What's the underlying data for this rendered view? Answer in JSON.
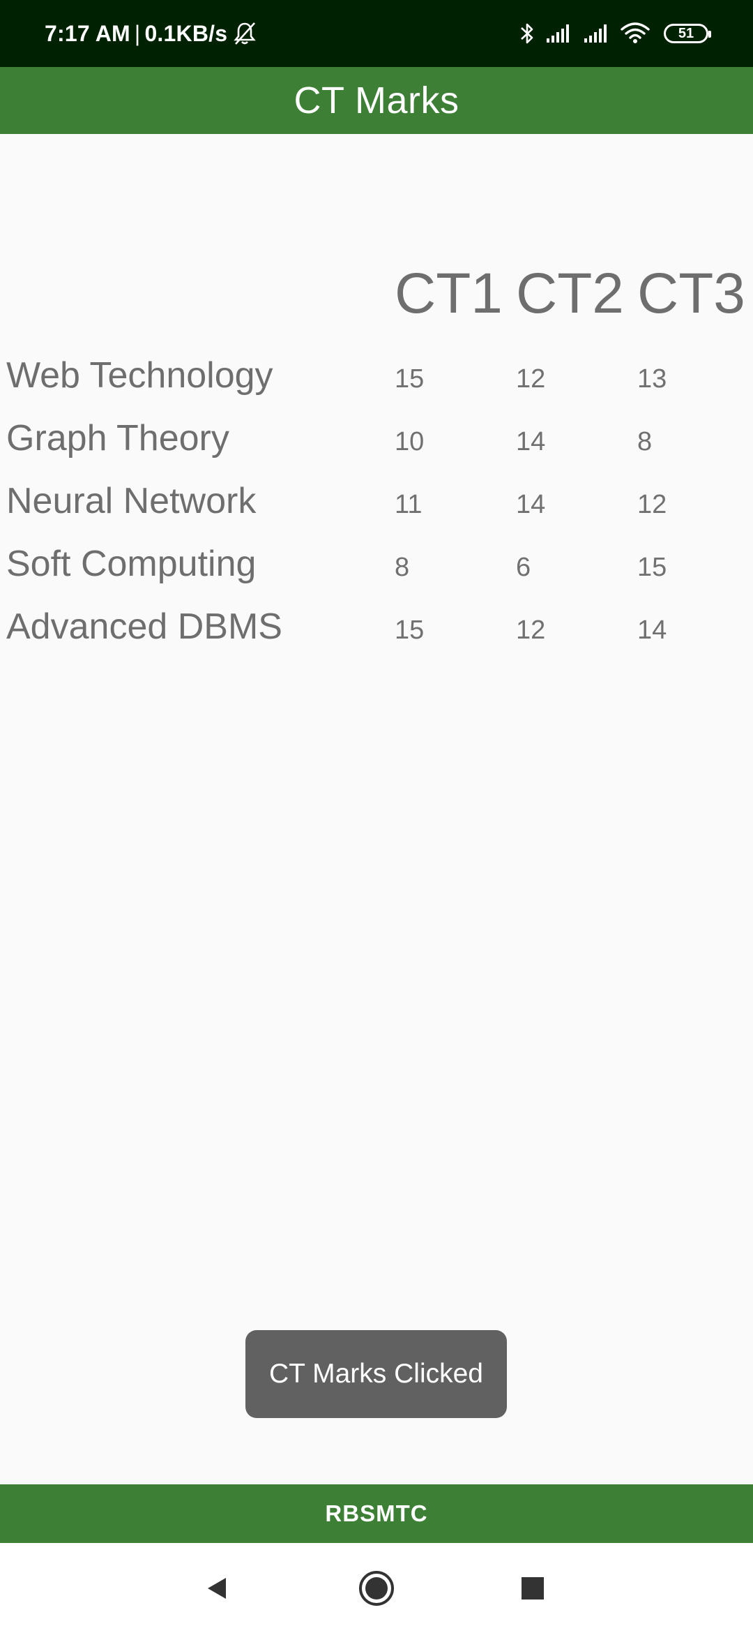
{
  "status_bar": {
    "time": "7:17 AM",
    "separator": "|",
    "network_speed": "0.1KB/s",
    "battery_level": "51",
    "icons": [
      "bell-off-icon",
      "bluetooth-icon",
      "signal-icon",
      "signal-icon",
      "wifi-icon",
      "battery-icon"
    ]
  },
  "app_bar": {
    "title": "CT Marks"
  },
  "marks_table": {
    "columns": [
      "CT1",
      "CT2",
      "CT3"
    ],
    "rows": [
      {
        "subject": "Web Technology",
        "marks": [
          "15",
          "12",
          "13"
        ]
      },
      {
        "subject": "Graph Theory",
        "marks": [
          "10",
          "14",
          "8"
        ]
      },
      {
        "subject": "Neural Network",
        "marks": [
          "11",
          "14",
          "12"
        ]
      },
      {
        "subject": "Soft Computing",
        "marks": [
          "8",
          "6",
          "15"
        ]
      },
      {
        "subject": "Advanced DBMS",
        "marks": [
          "15",
          "12",
          "14"
        ]
      }
    ]
  },
  "toast": {
    "message": "CT Marks Clicked"
  },
  "footer": {
    "label": "RBSMTC"
  },
  "nav_bar": {
    "buttons": [
      "back-icon",
      "home-icon",
      "recents-icon"
    ]
  },
  "colors": {
    "status_bar_bg": "#012202",
    "accent_green": "#3c7f35",
    "text_gray": "#6e6e6e",
    "toast_bg": "#616161",
    "background": "#fafafa"
  }
}
